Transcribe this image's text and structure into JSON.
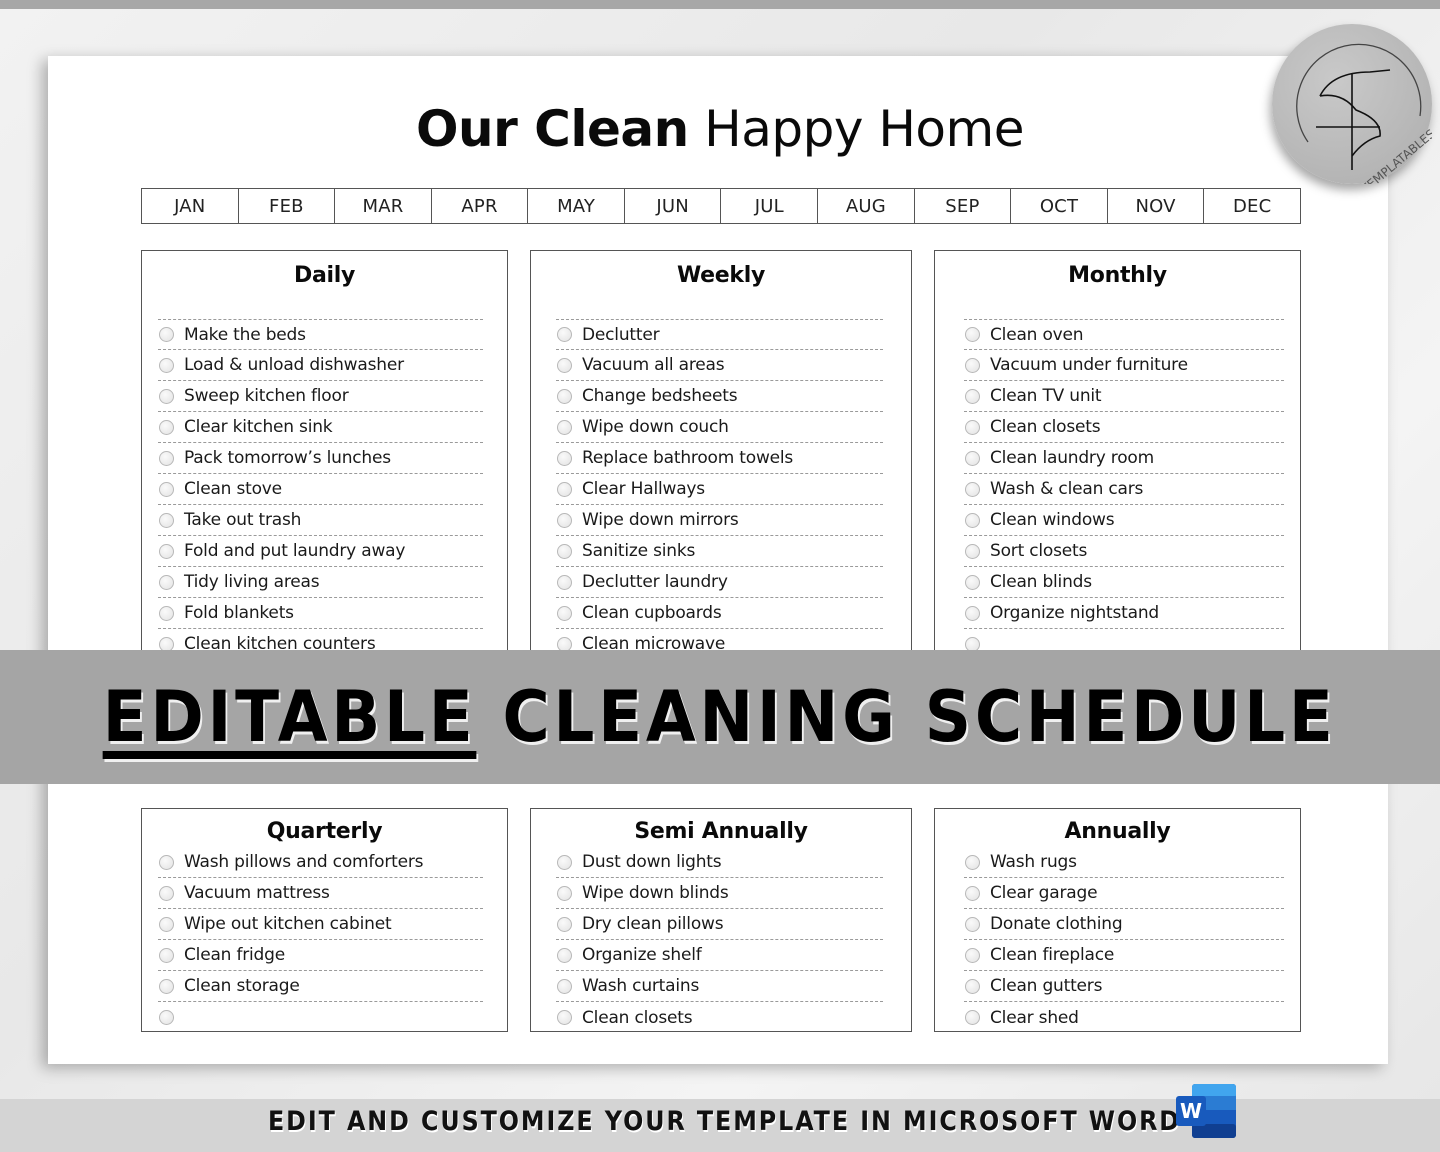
{
  "document": {
    "title_bold": "Our Clean",
    "title_light": "Happy Home",
    "months": [
      "JAN",
      "FEB",
      "MAR",
      "APR",
      "MAY",
      "JUN",
      "JUL",
      "AUG",
      "SEP",
      "OCT",
      "NOV",
      "DEC"
    ]
  },
  "badge": {
    "brand": "TEMPLATABLES",
    "logo_icon": "tf-monogram-icon"
  },
  "sections": {
    "daily": {
      "heading": "Daily",
      "items": [
        "Make the beds",
        "Load & unload dishwasher",
        "Sweep kitchen floor",
        "Clear kitchen sink",
        "Pack tomorrow’s lunches",
        "Clean stove",
        "Take out trash",
        "Fold and put laundry away",
        "Tidy living areas",
        "Fold blankets",
        "Clean kitchen counters"
      ]
    },
    "weekly": {
      "heading": "Weekly",
      "items": [
        "Declutter",
        "Vacuum all areas",
        "Change bedsheets",
        "Wipe down couch",
        "Replace bathroom towels",
        "Clear Hallways",
        "Wipe down mirrors",
        "Sanitize sinks",
        "Declutter laundry",
        "Clean cupboards",
        "Clean microwave"
      ]
    },
    "monthly": {
      "heading": "Monthly",
      "items": [
        "Clean oven",
        "Vacuum under furniture",
        "Clean TV unit",
        "Clean closets",
        "Clean laundry room",
        "Wash & clean cars",
        "Clean windows",
        "Sort closets",
        "Clean blinds",
        "Organize nightstand",
        ""
      ]
    },
    "quarterly": {
      "heading": "Quarterly",
      "items": [
        "Wash pillows and comforters",
        "Vacuum mattress",
        "Wipe out kitchen cabinet",
        "Clean fridge",
        "Clean storage",
        ""
      ]
    },
    "semi_annually": {
      "heading": "Semi Annually",
      "items": [
        "Dust down lights",
        "Wipe down blinds",
        "Dry clean pillows",
        "Organize shelf",
        "Wash curtains",
        "Clean closets"
      ]
    },
    "annually": {
      "heading": "Annually",
      "items": [
        "Wash rugs",
        "Clear garage",
        "Donate clothing",
        "Clean fireplace",
        "Clean gutters",
        "Clear shed"
      ]
    }
  },
  "banner": {
    "underlined_word": "EDITABLE",
    "rest": " CLEANING SCHEDULE"
  },
  "footer": {
    "text": "EDIT AND CUSTOMIZE YOUR TEMPLATE IN MICROSOFT WORD",
    "app_icon": "microsoft-word-icon",
    "app_letter": "W"
  },
  "colors": {
    "banner_bg": "#a5a5a5",
    "footer_bg": "#d4d4d4",
    "word_blue": "#185abd",
    "word_light": "#41a5ee"
  }
}
